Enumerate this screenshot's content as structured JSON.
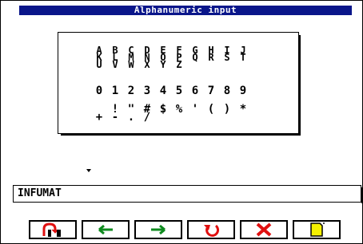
{
  "window": {
    "title": "Alphanumeric input"
  },
  "keyboard": {
    "letter_columns": [
      [
        "A",
        "K",
        "U"
      ],
      [
        "B",
        "L",
        "V"
      ],
      [
        "C",
        "M",
        "W"
      ],
      [
        "D",
        "N",
        "X"
      ],
      [
        "E",
        "O",
        "Y"
      ],
      [
        "F",
        "P",
        "Z"
      ],
      [
        "G",
        "Q",
        ""
      ],
      [
        "H",
        "R",
        ""
      ],
      [
        "I",
        "S",
        ""
      ],
      [
        "J",
        "T",
        ""
      ]
    ],
    "digits": [
      "0",
      "1",
      "2",
      "3",
      "4",
      "5",
      "6",
      "7",
      "8",
      "9"
    ],
    "symbols_row1": [
      "!",
      "\"",
      "#",
      "$",
      "%",
      "'",
      "(",
      ")",
      "*"
    ],
    "symbols_row2": [
      "+",
      "-",
      ".",
      "/"
    ]
  },
  "input": {
    "value": "INFUMAT"
  },
  "toolbar": {
    "buttons": [
      {
        "icon": "door-exit-icon"
      },
      {
        "icon": "arrow-left-icon"
      },
      {
        "icon": "arrow-right-icon"
      },
      {
        "icon": "undo-icon"
      },
      {
        "icon": "delete-x-icon"
      },
      {
        "icon": "confirm-note-icon"
      }
    ]
  },
  "colors": {
    "titlebar": "#0a168a",
    "arrow_green": "#0e8a1e",
    "icon_red": "#e01010",
    "note_yellow": "#f4f000"
  }
}
